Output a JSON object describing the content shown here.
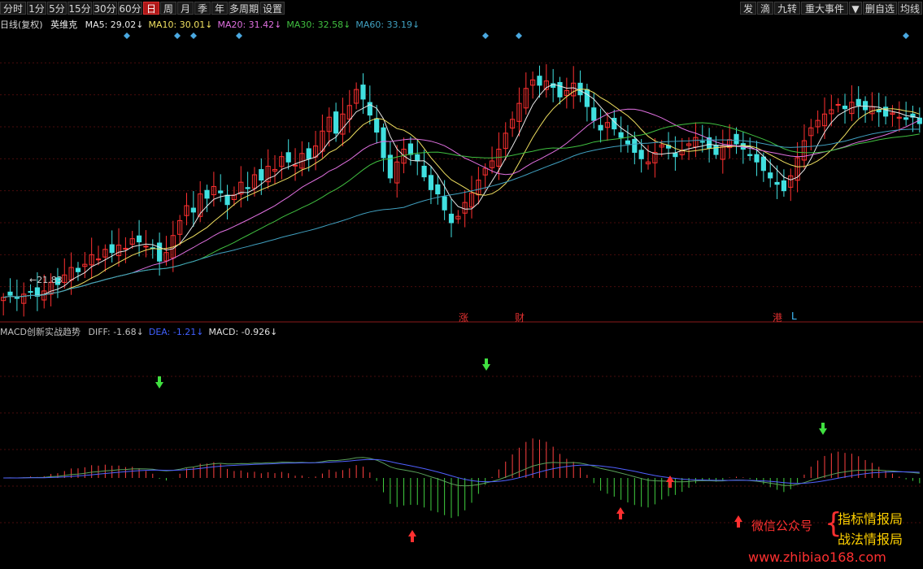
{
  "toolbar": {
    "left": [
      "分时",
      "1分",
      "5分",
      "15分",
      "30分",
      "60分",
      "日",
      "周",
      "月",
      "季",
      "年",
      "多周期",
      "设置"
    ],
    "active": "日",
    "right": [
      "发",
      "滴",
      "九转",
      "重大事件",
      "▼",
      "删自选",
      "均线"
    ]
  },
  "legend": {
    "period": "日线(复权)",
    "stock": "英维克",
    "items": [
      {
        "label": "MA5: 29.02",
        "arrow": "↓",
        "color": "#e8e8e8"
      },
      {
        "label": "MA10: 30.01",
        "arrow": "↓",
        "color": "#f0e060"
      },
      {
        "label": "MA20: 31.42",
        "arrow": "↓",
        "color": "#e070e0"
      },
      {
        "label": "MA30: 32.58",
        "arrow": "↓",
        "color": "#40c040"
      },
      {
        "label": "MA60: 33.19",
        "arrow": "↓",
        "color": "#40a0c0"
      }
    ]
  },
  "low_marker": "←21.83",
  "event_labels": [
    "涨",
    "财",
    "港",
    "L"
  ],
  "macd_legend": {
    "name": "MACD创新实战趋势",
    "items": [
      {
        "label": "DIFF: -1.68",
        "arrow": "↓",
        "color": "#c0c0c0"
      },
      {
        "label": "DEA: -1.21",
        "arrow": "↓",
        "color": "#4060ff"
      },
      {
        "label": "MACD: -0.926",
        "arrow": "↓",
        "color": "#e0e0e0"
      }
    ]
  },
  "watermark": {
    "wechat": "微信公众号",
    "brand1": "指标情报局",
    "brand2": "战法情报局",
    "url": "www.zhibiao168.com"
  },
  "colors": {
    "up": "#ff3030",
    "down": "#40e0e0",
    "grid": "#4a0c0c",
    "divider": "#8a1a1a"
  },
  "chart_data": {
    "type": "candlestick",
    "price_range": [
      21.0,
      48.0
    ],
    "low_label": 21.83,
    "closes": [
      23.0,
      23.2,
      22.9,
      23.3,
      23.5,
      23.1,
      23.6,
      24.4,
      24.2,
      25.1,
      25.8,
      25.4,
      26.1,
      27.0,
      26.6,
      27.5,
      27.2,
      27.9,
      27.6,
      28.5,
      28.2,
      27.8,
      27.6,
      26.4,
      27.2,
      28.8,
      30.2,
      31.6,
      31.0,
      32.7,
      32.3,
      33.4,
      32.8,
      31.7,
      32.6,
      33.8,
      33.2,
      34.5,
      34.0,
      35.3,
      35.0,
      36.2,
      35.7,
      35.4,
      36.5,
      36.0,
      37.2,
      38.6,
      39.9,
      38.4,
      40.2,
      41.0,
      42.5,
      41.6,
      40.1,
      38.5,
      36.1,
      34.2,
      35.7,
      36.9,
      36.4,
      35.8,
      34.3,
      33.1,
      32.7,
      31.2,
      30.0,
      30.6,
      31.9,
      32.8,
      34.0,
      35.1,
      35.8,
      36.9,
      38.4,
      39.7,
      41.2,
      42.6,
      43.4,
      42.9,
      43.3,
      42.7,
      41.8,
      42.4,
      43.1,
      42.0,
      40.9,
      39.6,
      38.7,
      39.4,
      38.8,
      38.0,
      37.4,
      36.6,
      36.0,
      35.7,
      36.6,
      37.3,
      37.0,
      36.2,
      36.8,
      37.4,
      38.0,
      37.6,
      37.0,
      36.4,
      37.2,
      37.8,
      37.4,
      36.9,
      36.3,
      35.7,
      34.9,
      34.2,
      33.6,
      33.0,
      34.4,
      36.1,
      37.7,
      38.9,
      39.6,
      40.2,
      40.6,
      41.1,
      40.7,
      41.3,
      41.0,
      40.6,
      40.9,
      40.4,
      40.0,
      40.3,
      39.9,
      39.7,
      39.9,
      39.3
    ]
  }
}
